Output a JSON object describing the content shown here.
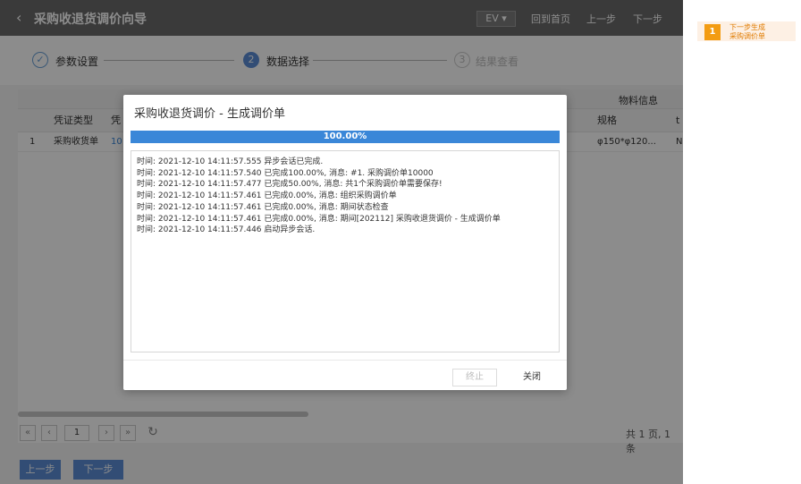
{
  "header": {
    "title": "采购收退货调价向导",
    "org_select": "EV ▾",
    "nav_home": "回到首页",
    "nav_prev": "上一步",
    "nav_next": "下一步"
  },
  "steps": [
    {
      "num": "✓",
      "label": "参数设置"
    },
    {
      "num": "2",
      "label": "数据选择"
    },
    {
      "num": "3",
      "label": "结果查看"
    }
  ],
  "table": {
    "group_header": "物料信息",
    "columns": [
      "凭证类型",
      "凭",
      "规格",
      "t"
    ],
    "row": {
      "index": "1",
      "type": "采购收货单",
      "num": "10",
      "spec": "φ150*φ120...",
      "extra": "N"
    }
  },
  "pagination": {
    "page": "1",
    "total": "共 1 页, 1 条"
  },
  "bottom": {
    "prev": "上一步",
    "next": "下一步"
  },
  "dialog": {
    "title": "采购收退货调价 - 生成调价单",
    "progress_text": "100.00%",
    "progress_value": 1.0,
    "log": [
      "时间: 2021-12-10 14:11:57.555 异步会话已完成.",
      "时间: 2021-12-10 14:11:57.540 已完成100.00%, 消息: #1. 采购调价单10000",
      "时间: 2021-12-10 14:11:57.477 已完成50.00%, 消息: 共1个采购调价单需要保存!",
      "时间: 2021-12-10 14:11:57.461 已完成0.00%, 消息: 组织采购调价单",
      "时间: 2021-12-10 14:11:57.461 已完成0.00%, 消息: 期间状态检查",
      "时间: 2021-12-10 14:11:57.461 已完成0.00%, 消息: 期间[202112] 采购收退货调价 - 生成调价单",
      "时间: 2021-12-10 14:11:57.446 启动异步会话."
    ],
    "stop_label": "终止",
    "close_label": "关闭"
  },
  "annotation": {
    "badge": "1",
    "line1": "下一步生成",
    "line2": "采购调价单"
  },
  "colors": {
    "header_bg": "#6b6b6b",
    "progress": "#3a87d8",
    "primary_button": "#5b8dd6",
    "annotation_badge": "#f39c12"
  }
}
